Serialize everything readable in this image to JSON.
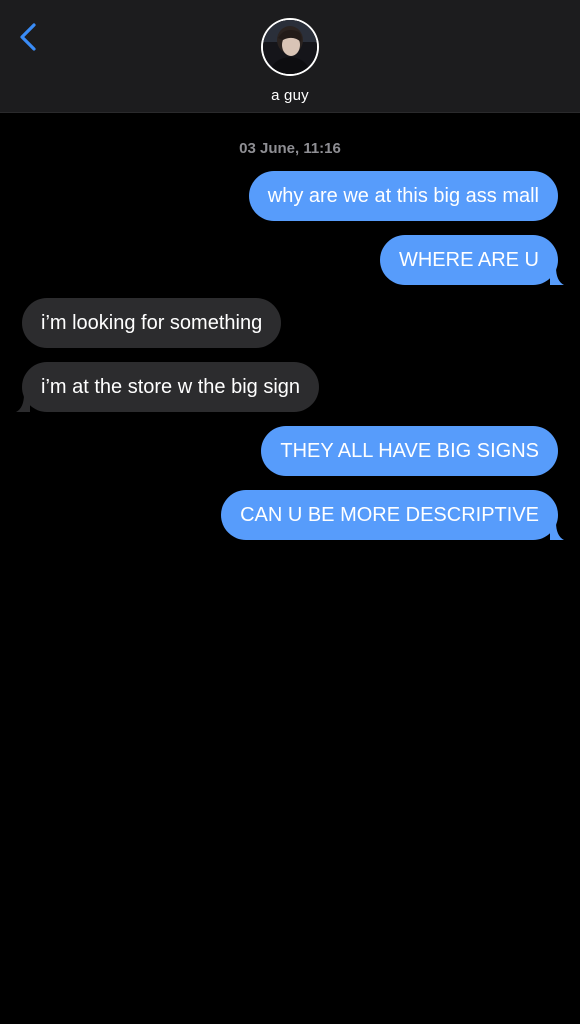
{
  "header": {
    "contact_name": "a guy"
  },
  "conversation": {
    "timestamp": "03 June, 11:16",
    "messages": [
      {
        "direction": "outgoing",
        "text": "why are we at this big ass mall"
      },
      {
        "direction": "outgoing",
        "text": "WHERE ARE U"
      },
      {
        "direction": "incoming",
        "text": "i’m looking for something"
      },
      {
        "direction": "incoming",
        "text": "i’m at the store w the big sign"
      },
      {
        "direction": "outgoing",
        "text": "THEY ALL HAVE BIG SIGNS"
      },
      {
        "direction": "outgoing",
        "text": "CAN U BE MORE DESCRIPTIVE"
      }
    ]
  },
  "icons": {
    "back": "chevron-left-icon",
    "avatar": "contact-avatar"
  },
  "colors": {
    "background": "#000000",
    "header_background": "#1c1c1e",
    "outgoing_bubble": "#579cfb",
    "incoming_bubble": "#2c2c2e",
    "accent": "#3a8cf7",
    "timestamp": "#8e8e93"
  }
}
